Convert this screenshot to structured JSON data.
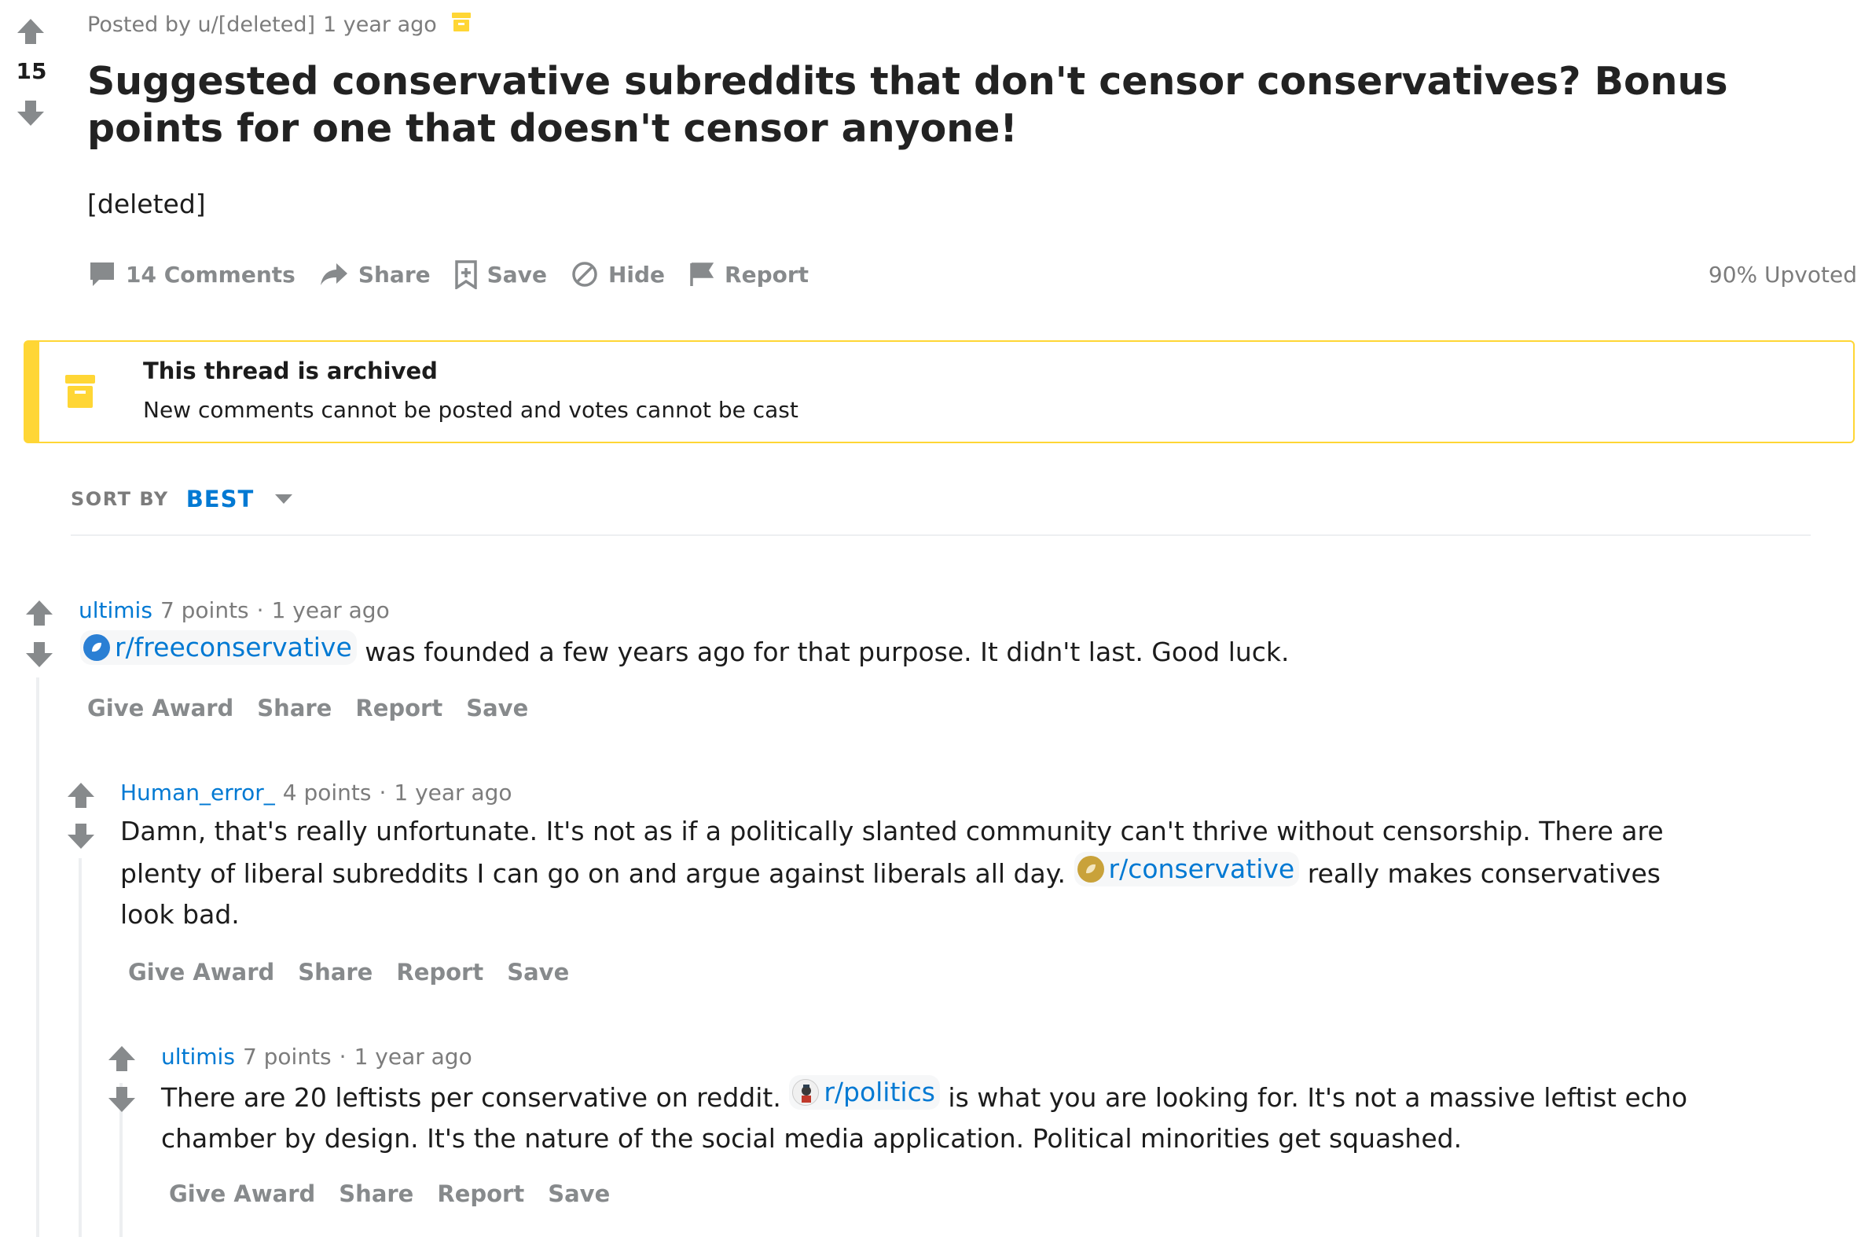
{
  "post": {
    "score": "15",
    "author": "Posted by u/[deleted]",
    "time": "1 year ago",
    "title": "Suggested conservative subreddits that don't censor conservatives? Bonus points for one that doesn't censor anyone!",
    "body": "[deleted]",
    "actions": {
      "comments": "14 Comments",
      "share": "Share",
      "save": "Save",
      "hide": "Hide",
      "report": "Report"
    },
    "upvoted": "90% Upvoted"
  },
  "archive_notice": {
    "title": "This thread is archived",
    "text": "New comments cannot be posted and votes cannot be cast"
  },
  "sort": {
    "label": "SORT BY",
    "value": "BEST"
  },
  "comments": [
    {
      "user": "ultimis",
      "points": "7 points",
      "sep": "·",
      "time": "1 year ago",
      "chip": "r/freeconservative",
      "text_after": "was founded a few years ago for that purpose. It didn't last. Good luck.",
      "actions": [
        "Give Award",
        "Share",
        "Report",
        "Save"
      ]
    },
    {
      "user": "Human_error_",
      "points": "4 points",
      "sep": "·",
      "time": "1 year ago",
      "text_before": "Damn, that's really unfortunate. It's not as if a politically slanted community can't thrive without censorship. There are plenty of liberal subreddits I can go on and argue against liberals all day.",
      "chip": "r/conservative",
      "text_after": "really makes conservatives look bad.",
      "actions": [
        "Give Award",
        "Share",
        "Report",
        "Save"
      ]
    },
    {
      "user": "ultimis",
      "points": "7 points",
      "sep": "·",
      "time": "1 year ago",
      "text_before": "There are 20 leftists per conservative on reddit.",
      "chip": "r/politics",
      "text_after": "is what you are looking for. It's not a massive leftist echo chamber by design. It's the nature of the social media application. Political minorities get squashed.",
      "actions": [
        "Give Award",
        "Share",
        "Report",
        "Save"
      ]
    }
  ],
  "colors": {
    "link": "#0079d3",
    "muted": "#878a8c",
    "archive_yellow": "#ffd635"
  }
}
